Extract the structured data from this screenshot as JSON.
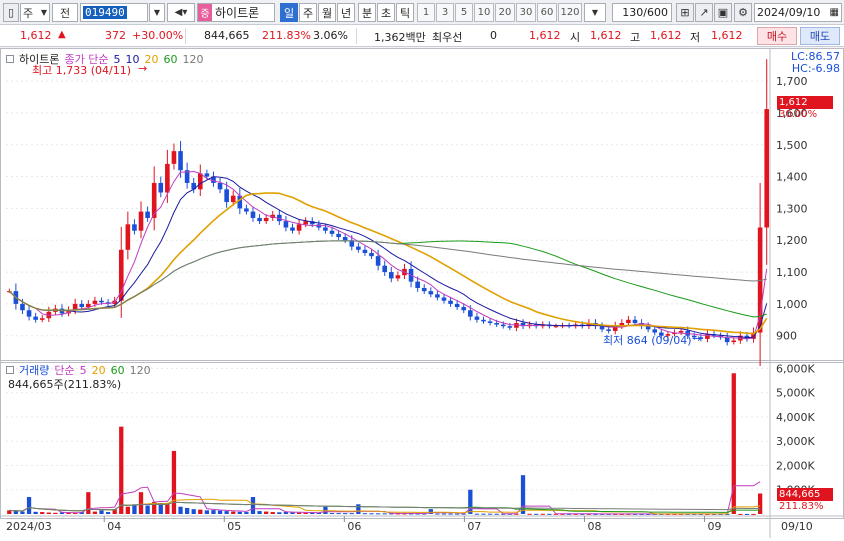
{
  "toolbar": {
    "market_label": "주",
    "type_label": "전",
    "code_value": "019490",
    "stock_tag": "증",
    "stock_name": "하이트론",
    "periods": [
      "일",
      "주",
      "월",
      "년",
      "분",
      "초",
      "틱"
    ],
    "active_period": "일",
    "intervals": [
      "1",
      "3",
      "5",
      "10",
      "20",
      "30",
      "60",
      "120"
    ],
    "count_value": "130/600",
    "date_value": "2024/09/10"
  },
  "info": {
    "price": "1,612",
    "change": "372",
    "change_rate": "+30.00%",
    "volume": "844,665",
    "volume_ratio": "211.83%",
    "turnover": "3.06%",
    "amount": "1,362백만",
    "pref_label": "최우선",
    "pref_value": "0",
    "ask_price": "1,612",
    "open_label": "시",
    "open_value": "1,612",
    "high_label": "고",
    "high_value": "1,612",
    "low_label": "저",
    "low_value": "1,612",
    "buy_label": "매수",
    "sell_label": "매도"
  },
  "price_panel": {
    "stock_label": "하이트론",
    "legend_label": "종가 단순",
    "ma_periods": [
      "5",
      "10",
      "20",
      "60",
      "120"
    ],
    "ma_colors": [
      "#c03cc0",
      "#1a1aa0",
      "#e0a000",
      "#1a9a1a",
      "#7a7a7a"
    ],
    "high_note": "최고 1,733 (04/11)",
    "low_note": "최저 864 (09/04)",
    "lc": "LC:86.57",
    "hc": "HC:-6.98",
    "price_badge": "1,612",
    "pct_badge": "30.00%"
  },
  "volume_panel": {
    "label": "거래량",
    "legend_label": "단순",
    "ma_periods": [
      "5",
      "20",
      "60",
      "120"
    ],
    "ma_colors": [
      "#c03cc0",
      "#e0a000",
      "#1a9a1a",
      "#7a7a7a"
    ],
    "current": "844,665주(211.83%)",
    "badge_value": "844,665",
    "badge_pct": "211.83%"
  },
  "chart_data": {
    "type": "candlestick",
    "price_axis": {
      "ylim": [
        830,
        1760
      ],
      "ticks": [
        "1,700",
        "1,600",
        "1,500",
        "1,400",
        "1,300",
        "1,200",
        "1,100",
        "1,000",
        "900"
      ]
    },
    "volume_axis": {
      "ylim": [
        0,
        6100000
      ],
      "ticks": [
        "6,000K",
        "5,000K",
        "4,000K",
        "3,000K",
        "2,000K",
        "1,000K"
      ]
    },
    "x_labels": [
      "2024/03",
      "04",
      "05",
      "06",
      "07",
      "08",
      "09",
      "09/10"
    ],
    "series": [
      {
        "name": "close",
        "values": [
          1040,
          1000,
          980,
          960,
          950,
          955,
          975,
          985,
          970,
          980,
          1000,
          990,
          1000,
          1010,
          1005,
          1000,
          1010,
          1170,
          1250,
          1230,
          1290,
          1270,
          1380,
          1350,
          1440,
          1480,
          1420,
          1380,
          1360,
          1410,
          1400,
          1380,
          1360,
          1320,
          1340,
          1300,
          1290,
          1270,
          1260,
          1270,
          1280,
          1260,
          1240,
          1230,
          1250,
          1260,
          1250,
          1240,
          1230,
          1220,
          1210,
          1200,
          1180,
          1170,
          1160,
          1150,
          1120,
          1100,
          1080,
          1090,
          1110,
          1070,
          1050,
          1040,
          1030,
          1020,
          1010,
          1000,
          990,
          980,
          960,
          950,
          945,
          940,
          935,
          930,
          925,
          940,
          930,
          935,
          930,
          935,
          930,
          930,
          932,
          930,
          935,
          930,
          940,
          930,
          920,
          915,
          930,
          940,
          950,
          940,
          930,
          920,
          910,
          900,
          905,
          910,
          915,
          900,
          895,
          890,
          905,
          900,
          895,
          880,
          885,
          900,
          890,
          910,
          1240,
          1612
        ]
      },
      {
        "name": "volume",
        "values": [
          150000,
          120000,
          100000,
          700000,
          90000,
          80000,
          60000,
          50000,
          70000,
          40000,
          50000,
          80000,
          900000,
          100000,
          150000,
          80000,
          200000,
          3600000,
          300000,
          400000,
          900000,
          350000,
          500000,
          450000,
          400000,
          2600000,
          300000,
          250000,
          200000,
          180000,
          150000,
          160000,
          140000,
          120000,
          100000,
          90000,
          80000,
          700000,
          120000,
          100000,
          80000,
          70000,
          90000,
          60000,
          55000,
          50000,
          48000,
          45000,
          300000,
          40000,
          38000,
          36000,
          35000,
          400000,
          33000,
          30000,
          28000,
          26000,
          25000,
          24000,
          23000,
          22000,
          21000,
          20000,
          200000,
          19000,
          18000,
          17000,
          16000,
          15000,
          1000000,
          14000,
          13000,
          12000,
          11000,
          10000,
          9500,
          9000,
          1600000,
          9000,
          8500,
          8000,
          8000,
          7500,
          7000,
          7000,
          6500,
          6000,
          6000,
          5500,
          5500,
          5000,
          5000,
          4500,
          4500,
          4000,
          4000,
          3800,
          3600,
          3500,
          3400,
          3300,
          3200,
          3100,
          3000,
          2900,
          2800,
          2700,
          2600,
          2500,
          5800000,
          2400,
          2300,
          2200,
          844665
        ]
      }
    ]
  }
}
